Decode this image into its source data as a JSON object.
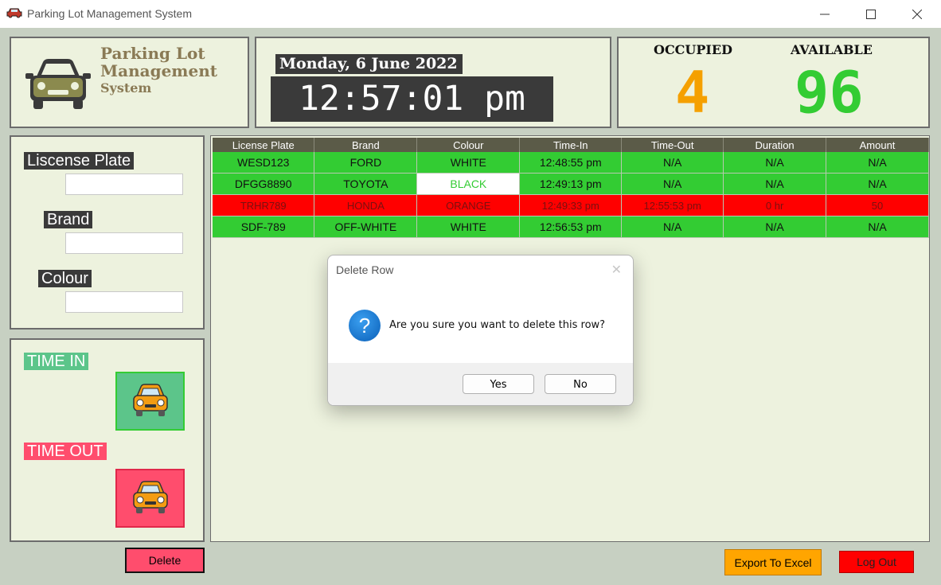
{
  "window": {
    "title": "Parking Lot Management System"
  },
  "logo": {
    "line1": "Parking Lot",
    "line2": "Management",
    "line3": "System"
  },
  "clock": {
    "date": "Monday, 6 June 2022",
    "time": "12:57:01 pm"
  },
  "stats": {
    "occupied_label": "OCCUPIED",
    "occupied_value": "4",
    "available_label": "AVAILABLE",
    "available_value": "96"
  },
  "form": {
    "plate_label": "Liscense Plate",
    "brand_label": "Brand",
    "colour_label": "Colour",
    "plate_value": "",
    "brand_value": "",
    "colour_value": ""
  },
  "actions": {
    "time_in": "TIME IN",
    "time_out": "TIME OUT",
    "delete": "Delete",
    "export": "Export To Excel",
    "logout": "Log Out"
  },
  "table": {
    "columns": [
      "License Plate",
      "Brand",
      "Colour",
      "Time-In",
      "Time-Out",
      "Duration",
      "Amount"
    ],
    "rows": [
      [
        "WESD123",
        "FORD",
        "WHITE",
        "12:48:55 pm",
        "N/A",
        "N/A",
        "N/A"
      ],
      [
        "DFGG8890",
        "TOYOTA",
        "BLACK",
        "12:49:13 pm",
        "N/A",
        "N/A",
        "N/A"
      ],
      [
        "TRHR789",
        "HONDA",
        "ORANGE",
        "12:49:33 pm",
        "12:55:53 pm",
        "0 hr",
        "50"
      ],
      [
        "SDF-789",
        "OFF-WHITE",
        "WHITE",
        "12:56:53 pm",
        "N/A",
        "N/A",
        "N/A"
      ]
    ]
  },
  "dialog": {
    "title": "Delete Row",
    "message": "Are you sure you want to delete this row?",
    "yes": "Yes",
    "no": "No"
  },
  "colors": {
    "occupied": "#f5a000",
    "available": "#33cc33",
    "time_in": "#5cc58a",
    "time_out": "#ff4d6d",
    "row_green": "#33cc33",
    "row_red": "#ff0000"
  }
}
